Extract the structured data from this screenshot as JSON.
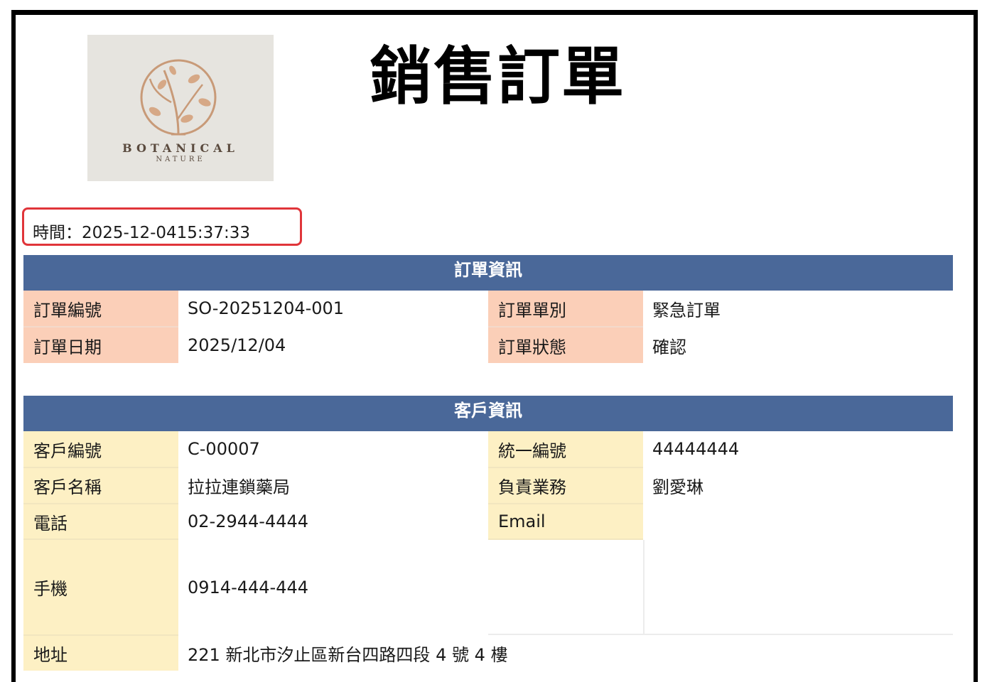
{
  "document": {
    "title": "銷售訂單",
    "timestamp": "時間：2025-12-0415:37:33"
  },
  "logo": {
    "brand": "BOTANICAL",
    "sub": "NATURE"
  },
  "order_info": {
    "header": "訂單資訊",
    "order_number_label": "訂單編號",
    "order_number": "SO-20251204-001",
    "order_type_label": "訂單單別",
    "order_type": "緊急訂單",
    "order_date_label": "訂單日期",
    "order_date": "2025/12/04",
    "order_status_label": "訂單狀態",
    "order_status": "確認"
  },
  "customer_info": {
    "header": "客戶資訊",
    "customer_id_label": "客戶編號",
    "customer_id": "C-00007",
    "tax_id_label": "統一編號",
    "tax_id": "44444444",
    "customer_name_label": "客戶名稱",
    "customer_name": "拉拉連鎖藥局",
    "sales_rep_label": "負責業務",
    "sales_rep": "劉愛琳",
    "phone_label": "電話",
    "phone": "02-2944-4444",
    "email_label": "Email",
    "email": "",
    "mobile_label": "手機",
    "mobile": "0914-444-444",
    "address_label": "地址",
    "address": "221 新北市汐止區新台四路四段 4 號 4 樓"
  },
  "colors": {
    "header_bg": "#4a6899",
    "label_order_bg": "#fbcfb8",
    "label_customer_bg": "#fdf0c4",
    "highlight_border": "#e0353a"
  }
}
